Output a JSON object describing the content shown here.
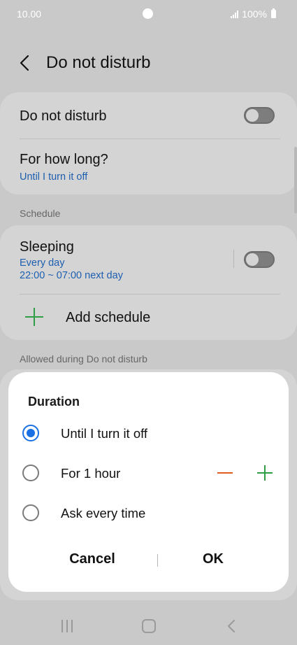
{
  "status_bar": {
    "time": "10.00",
    "battery": "100%"
  },
  "header": {
    "title": "Do not disturb"
  },
  "dnd_card": {
    "toggle_label": "Do not disturb",
    "toggle_on": false,
    "duration_title": "For how long?",
    "duration_value": "Until I turn it off"
  },
  "schedule": {
    "section_label": "Schedule",
    "items": [
      {
        "title": "Sleeping",
        "days": "Every day",
        "time": "22:00 ~ 07:00 next day",
        "enabled": false
      }
    ],
    "add_label": "Add schedule"
  },
  "allowed": {
    "section_label": "Allowed during Do not disturb"
  },
  "dialog": {
    "title": "Duration",
    "options": [
      {
        "label": "Until I turn it off",
        "selected": true
      },
      {
        "label": "For 1 hour",
        "selected": false
      },
      {
        "label": "Ask every time",
        "selected": false
      }
    ],
    "cancel_label": "Cancel",
    "ok_label": "OK"
  },
  "colors": {
    "accent_blue": "#1a6fe3",
    "link_blue": "#1d5fb0",
    "plus_green": "#2f9e44",
    "minus_orange": "#e25a1c"
  }
}
